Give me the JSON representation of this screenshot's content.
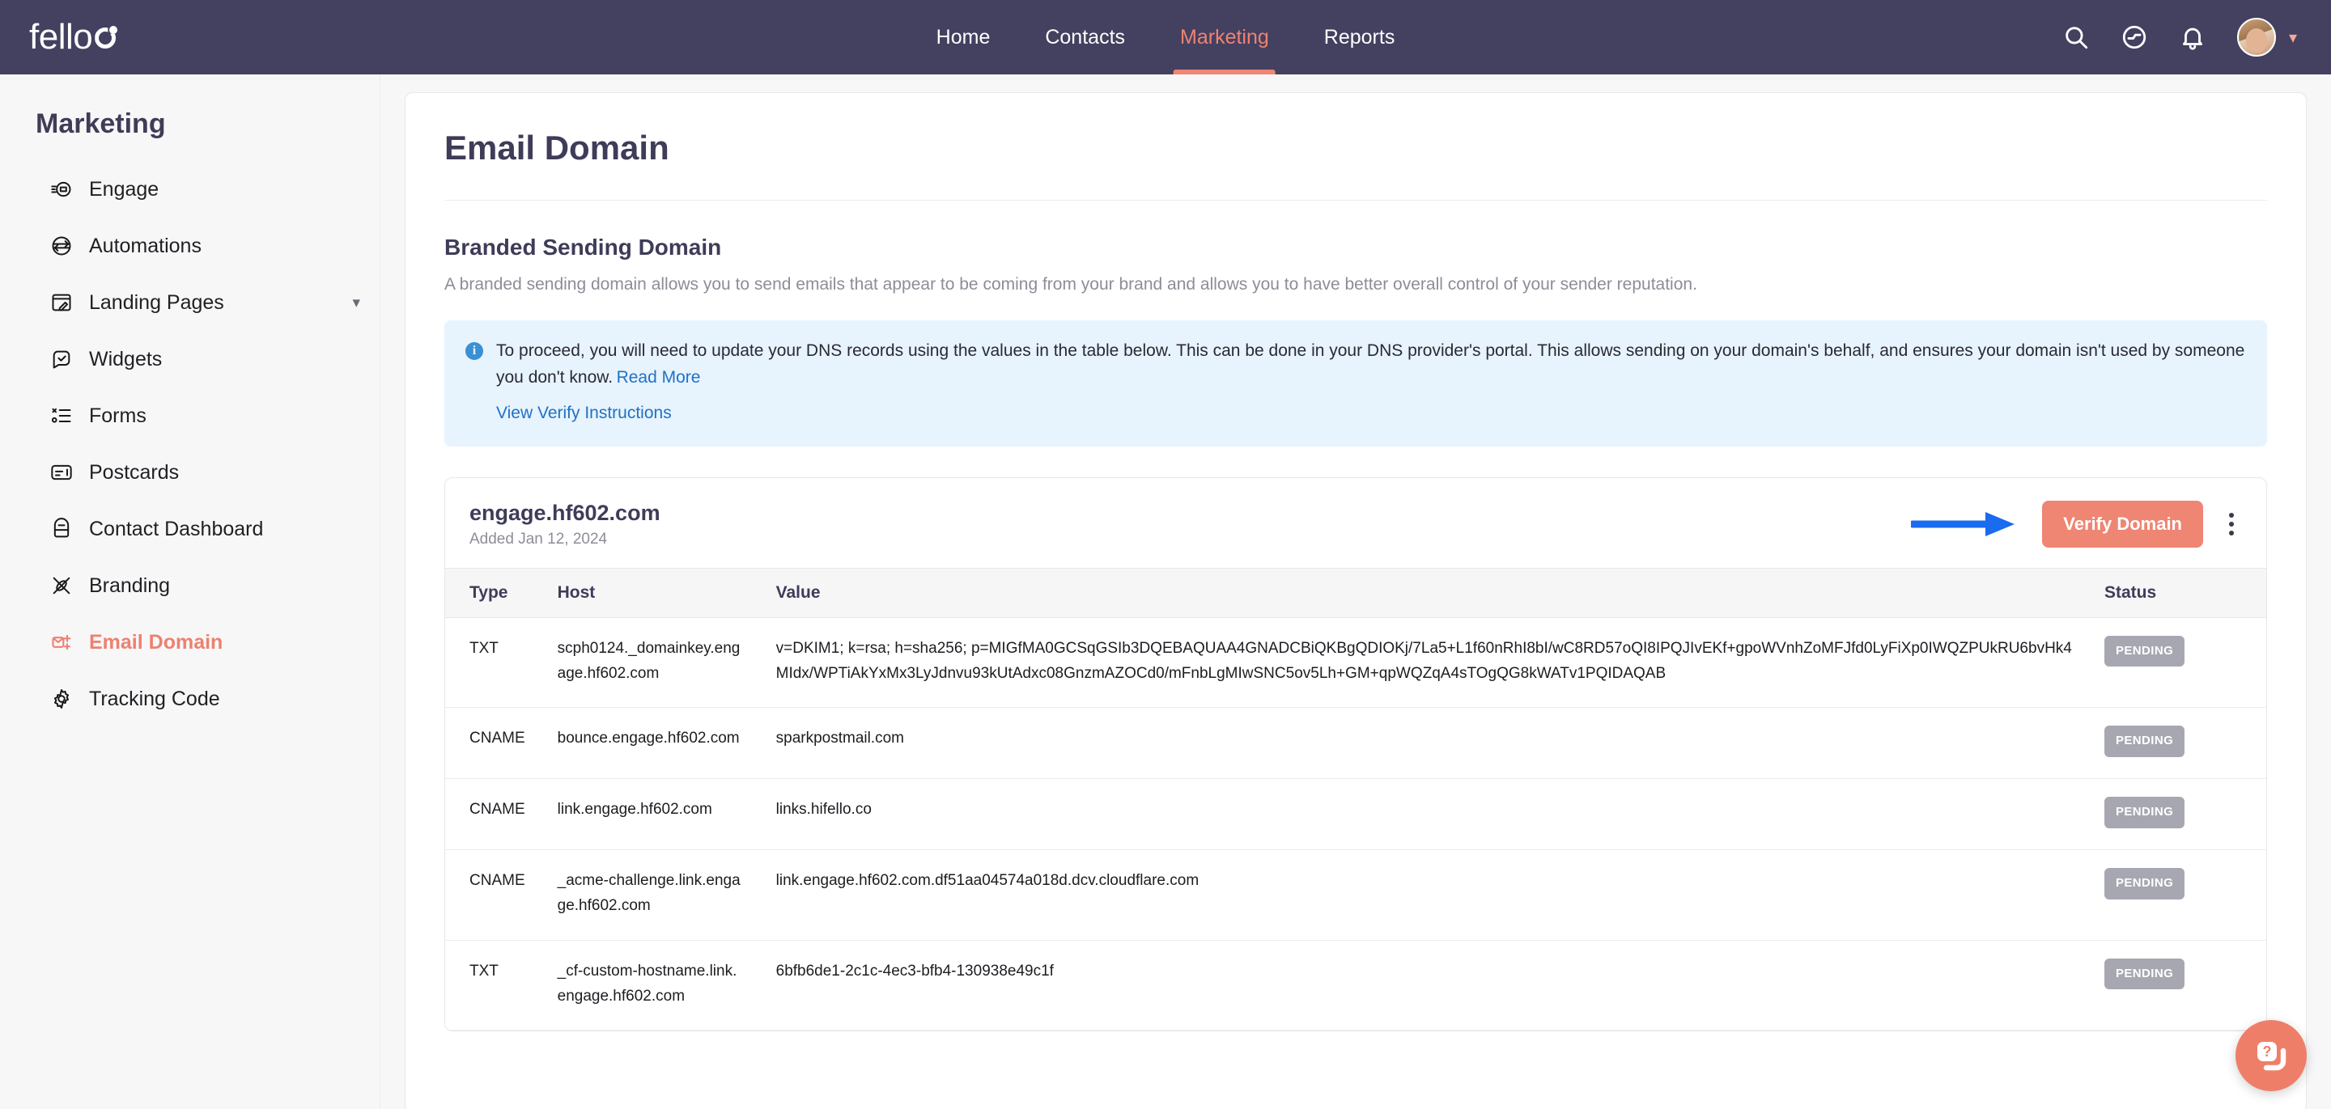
{
  "topnav": {
    "logo_text": "fello",
    "items": [
      {
        "label": "Home",
        "active": false
      },
      {
        "label": "Contacts",
        "active": false
      },
      {
        "label": "Marketing",
        "active": true
      },
      {
        "label": "Reports",
        "active": false
      }
    ],
    "icons": [
      "search-icon",
      "activity-icon",
      "bell-icon",
      "avatar",
      "chevron-down-icon"
    ],
    "accent_color": "#ef8573",
    "background_color": "#434060"
  },
  "sidebar": {
    "title": "Marketing",
    "items": [
      {
        "label": "Engage",
        "icon": "engage-icon",
        "active": false,
        "caret": false
      },
      {
        "label": "Automations",
        "icon": "automations-icon",
        "active": false,
        "caret": false
      },
      {
        "label": "Landing Pages",
        "icon": "landing-pages-icon",
        "active": false,
        "caret": true
      },
      {
        "label": "Widgets",
        "icon": "widgets-icon",
        "active": false,
        "caret": false
      },
      {
        "label": "Forms",
        "icon": "forms-icon",
        "active": false,
        "caret": false
      },
      {
        "label": "Postcards",
        "icon": "postcards-icon",
        "active": false,
        "caret": false
      },
      {
        "label": "Contact Dashboard",
        "icon": "contact-dashboard-icon",
        "active": false,
        "caret": false
      },
      {
        "label": "Branding",
        "icon": "branding-icon",
        "active": false,
        "caret": false
      },
      {
        "label": "Email Domain",
        "icon": "email-domain-icon",
        "active": true,
        "caret": false
      },
      {
        "label": "Tracking Code",
        "icon": "gear-icon",
        "active": false,
        "caret": false
      }
    ]
  },
  "main": {
    "page_title": "Email Domain",
    "section_title": "Branded Sending Domain",
    "section_desc": "A branded sending domain allows you to send emails that appear to be coming from your brand and allows you to have better overall control of your sender reputation.",
    "alert": {
      "text": "To proceed, you will need to update your DNS records using the values in the table below. This can be done in your DNS provider's portal. This allows sending on your domain's behalf, and ensures your domain isn't used by someone you don't know.",
      "read_more": "Read More",
      "instructions_link": "View Verify Instructions",
      "background_color": "#e7f3fd",
      "link_color": "#1f72c4"
    },
    "domain": {
      "name": "engage.hf602.com",
      "added": "Added Jan 12, 2024",
      "verify_button": "Verify Domain",
      "verify_button_color": "#ef8573",
      "kebab": "more-options-icon"
    },
    "table": {
      "columns": [
        "Type",
        "Host",
        "Value",
        "Status"
      ],
      "rows": [
        {
          "type": "TXT",
          "host": "scph0124._domainkey.engage.hf602.com",
          "value": "v=DKIM1; k=rsa; h=sha256; p=MIGfMA0GCSqGSIb3DQEBAQUAA4GNADCBiQKBgQDIOKj/7La5+L1f60nRhI8bI/wC8RD57oQI8IPQJIvEKf+gpoWVnhZoMFJfd0LyFiXp0IWQZPUkRU6bvHk4MIdx/WPTiAkYxMx3LyJdnvu93kUtAdxc08GnzmAZOCd0/mFnbLgMIwSNC5ov5Lh+GM+qpWQZqA4sTOgQG8kWATv1PQIDAQAB",
          "status": "PENDING"
        },
        {
          "type": "CNAME",
          "host": "bounce.engage.hf602.com",
          "value": "sparkpostmail.com",
          "status": "PENDING"
        },
        {
          "type": "CNAME",
          "host": "link.engage.hf602.com",
          "value": "links.hifello.co",
          "status": "PENDING"
        },
        {
          "type": "CNAME",
          "host": "_acme-challenge.link.engage.hf602.com",
          "value": "link.engage.hf602.com.df51aa04574a018d.dcv.cloudflare.com",
          "status": "PENDING"
        },
        {
          "type": "TXT",
          "host": "_cf-custom-hostname.link.engage.hf602.com",
          "value": "6bfb6de1-2c1c-4ec3-bfb4-130938e49c1f",
          "status": "PENDING"
        }
      ]
    }
  },
  "chat": {
    "icon": "help-chat-icon",
    "color": "#ef7e69"
  }
}
